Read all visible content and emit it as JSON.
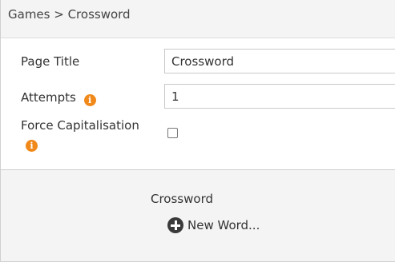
{
  "breadcrumb": "Games > Crossword",
  "fields": {
    "page_title": {
      "label": "Page Title",
      "value": "Crossword"
    },
    "attempts": {
      "label": "Attempts",
      "value": "1"
    },
    "force_capitalisation": {
      "label": "Force Capitalisation",
      "checked": false
    }
  },
  "icons": {
    "info": "info-icon",
    "add": "plus-circle-icon"
  },
  "colors": {
    "info_icon": "#f0891a",
    "add_icon": "#3a3a3a"
  },
  "section": {
    "title": "Crossword",
    "new_word_label": "New Word..."
  }
}
